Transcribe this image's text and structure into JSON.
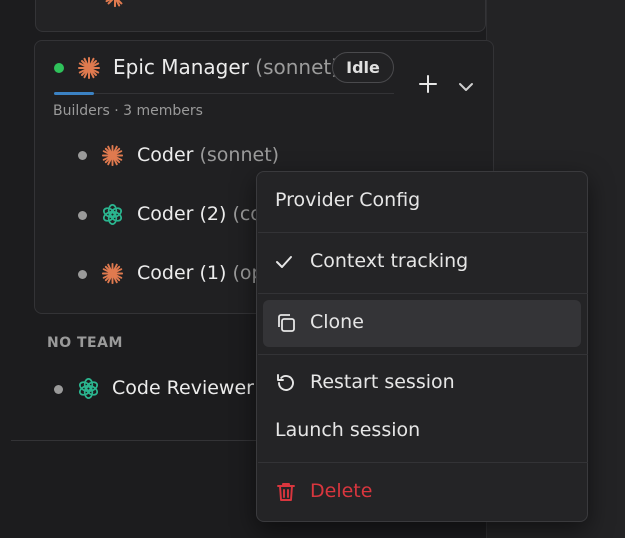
{
  "team": {
    "lead": {
      "name": "Epic Manager",
      "model": "(sonnet)",
      "status": "Idle"
    },
    "meta": "Builders · 3 members",
    "members": [
      {
        "name": "Coder",
        "model": "(sonnet)"
      },
      {
        "name": "Coder (2)",
        "model": "(co"
      },
      {
        "name": "Coder (1)",
        "model": "(op"
      }
    ]
  },
  "no_team": {
    "label": "NO TEAM",
    "members": [
      {
        "name": "Code Reviewer"
      }
    ]
  },
  "context_menu": {
    "provider_config": "Provider Config",
    "context_tracking": "Context tracking",
    "clone": "Clone",
    "restart_session": "Restart session",
    "launch_session": "Launch session",
    "delete": "Delete"
  },
  "icons": {
    "claude": "claude-asterisk-icon",
    "openai": "openai-knot-icon",
    "add": "plus-icon",
    "expand": "chevron-down-icon",
    "check": "check-icon",
    "clone": "copy-icon",
    "restart": "restart-icon",
    "delete": "trash-icon"
  },
  "colors": {
    "status_online": "#2fc25b",
    "claude": "#e07a4f",
    "openai": "#2bb58f",
    "danger": "#d9363e",
    "accent": "#3b82c4"
  }
}
